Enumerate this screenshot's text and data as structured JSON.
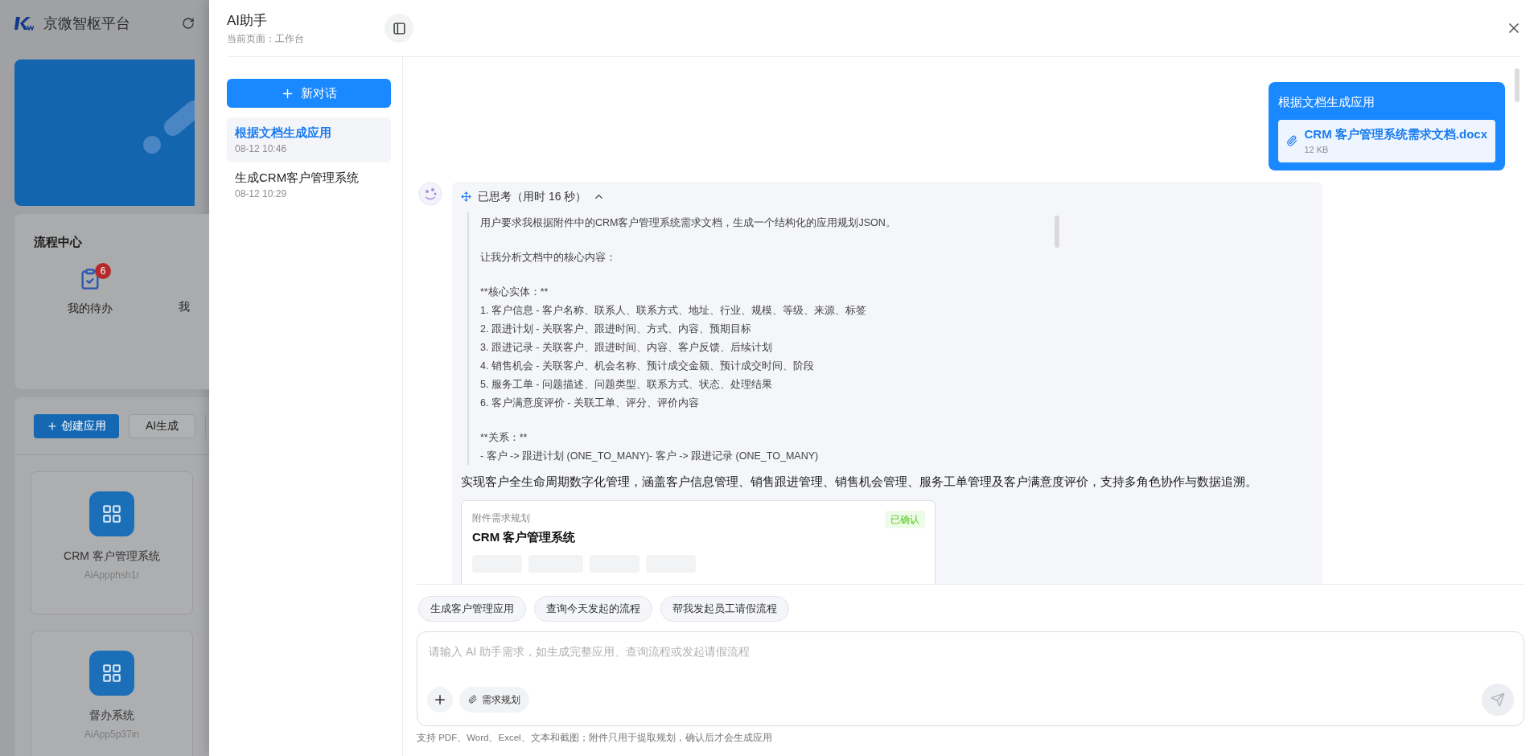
{
  "background_page": {
    "brand": "京微智枢平台",
    "process_center": {
      "title": "流程中心",
      "items": [
        {
          "label": "我的待办",
          "badge": "6"
        },
        {
          "label": "我"
        }
      ]
    },
    "toolbar": [
      {
        "label": "创建应用",
        "kind": "primary"
      },
      {
        "label": "AI生成",
        "kind": "default"
      }
    ],
    "apps": [
      {
        "name": "CRM 客户管理系统",
        "code": "AiAppphsh1r"
      },
      {
        "name": "督办系统",
        "code": "AiApp5p37in"
      }
    ]
  },
  "drawer": {
    "title": "AI助手",
    "subtitle": "当前页面：工作台"
  },
  "sidebar": {
    "new_chat": "新对话",
    "conversations": [
      {
        "title": "根据文档生成应用",
        "time": "08-12 10:46",
        "selected": true
      },
      {
        "title": "生成CRM客户管理系统",
        "time": "08-12 10:29",
        "selected": false
      }
    ]
  },
  "user_message": {
    "text": "根据文档生成应用",
    "attachment": {
      "name": "CRM 客户管理系统需求文档.docx",
      "size": "12 KB"
    }
  },
  "assistant_message": {
    "thinking": {
      "label": "已思考（用时 16 秒）",
      "expanded": true,
      "paragraphs": [
        [
          "用户要求我根据附件中的CRM客户管理系统需求文档，生成一个结构化的应用规划JSON。"
        ],
        [
          "让我分析文档中的核心内容："
        ],
        [
          "**核心实体：**",
          "1. 客户信息 - 客户名称、联系人、联系方式、地址、行业、规模、等级、来源、标签",
          "2. 跟进计划 - 关联客户、跟进时间、方式、内容、预期目标",
          "3. 跟进记录 - 关联客户、跟进时间、内容、客户反馈、后续计划",
          "4. 销售机会 - 关联客户、机会名称、预计成交金额、预计成交时间、阶段",
          "5. 服务工单 - 问题描述、问题类型、联系方式、状态、处理结果",
          "6. 客户满意度评价 - 关联工单、评分、评价内容"
        ],
        [
          "**关系：**",
          "- 客户 -> 跟进计划 (ONE_TO_MANY)- 客户 -> 跟进记录 (ONE_TO_MANY)"
        ]
      ]
    },
    "summary": "实现客户全生命周期数字化管理，涵盖客户信息管理、销售跟进管理、销售机会管理、服务工单管理及客户满意度评价，支持多角色协作与数据追溯。",
    "plan_card": {
      "label": "附件需求规划",
      "title": "CRM 客户管理系统",
      "status": "已确认"
    }
  },
  "suggestions": [
    "生成客户管理应用",
    "查询今天发起的流程",
    "帮我发起员工请假流程"
  ],
  "composer": {
    "placeholder": "请输入 AI 助手需求，如生成完整应用、查询流程或发起请假流程",
    "attach_label": "需求规划",
    "hint": "支持 PDF、Word、Excel、文本和截图；附件只用于提取规划，确认后才会生成应用"
  }
}
